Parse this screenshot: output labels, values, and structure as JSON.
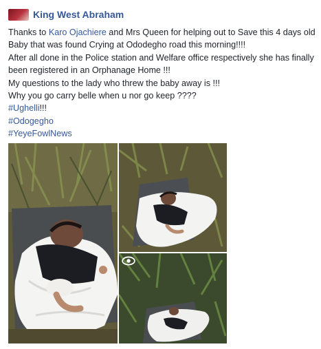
{
  "post": {
    "author": "King West Abraham",
    "lines": {
      "l1_pre": "Thanks to ",
      "l1_mention": "Karo Ojachiere",
      "l1_post": " and Mrs Queen for helping out to Save this 4 days old",
      "l2": "Baby that was found Crying at Ododegho road this morning!!!!",
      "l3": "After all done in the Police station and Welfare office respectively she has finally",
      "l4": "been registered in an Orphanage Home !!!",
      "l5": "My questions to the lady who threw the baby away is !!!",
      "l6": "Why you go carry belle when u nor go keep ????"
    },
    "hashtags": {
      "h1": "#Ughelli",
      "h1_suffix": "!!!",
      "h2": "#Odogegho",
      "h3": "#YeyeFowlNews"
    }
  },
  "colors": {
    "link": "#365899",
    "text": "#1d2129"
  },
  "icons": {
    "overlay": "eye-icon"
  }
}
